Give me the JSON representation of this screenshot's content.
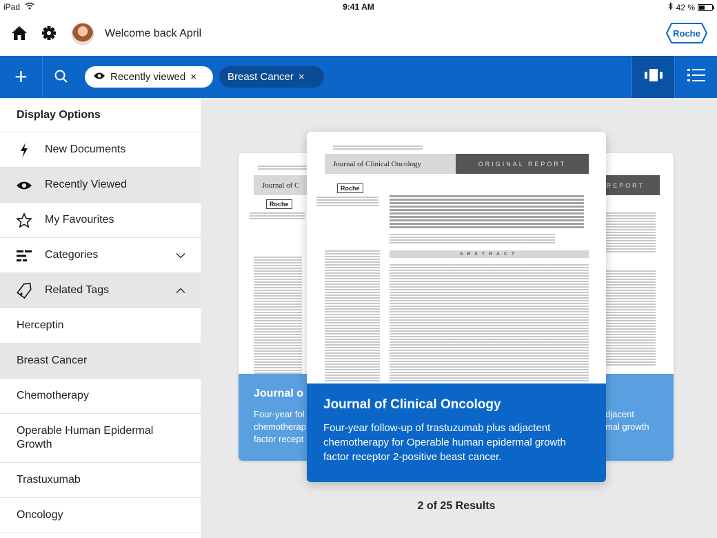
{
  "status_bar": {
    "device": "iPad",
    "time": "9:41 AM",
    "battery": "42 %"
  },
  "header": {
    "welcome": "Welcome back April",
    "logo_text": "Roche"
  },
  "toolbar": {
    "add_label": "+",
    "filters": [
      {
        "label": "Recently viewed",
        "close": "×"
      },
      {
        "label": "Breast Cancer",
        "close": "×"
      }
    ]
  },
  "sidebar": {
    "title": "Display Options",
    "items": [
      {
        "label": "New Documents",
        "icon": "bolt-icon"
      },
      {
        "label": "Recently Viewed",
        "icon": "eye-icon",
        "selected": true
      },
      {
        "label": "My Favourites",
        "icon": "star-icon"
      },
      {
        "label": "Categories",
        "icon": "categories-icon",
        "chevron": "down"
      },
      {
        "label": "Related Tags",
        "icon": "tag-icon",
        "chevron": "up"
      }
    ],
    "tags": [
      {
        "label": "Herceptin"
      },
      {
        "label": "Breast Cancer",
        "selected": true
      },
      {
        "label": "Chemotherapy"
      },
      {
        "label": "Operable Human Epidermal Growth"
      },
      {
        "label": "Trastuxumab"
      },
      {
        "label": "Oncology"
      }
    ]
  },
  "cards": {
    "front": {
      "journal_header": "Journal of Clinical Oncology",
      "report_label": "ORIGINAL REPORT",
      "abstract_label": "ABSTRACT",
      "logo": "Roche",
      "title": "Journal of Clinical Oncology",
      "description": "Four-year follow-up of trastuzumab plus adjactent chemotherapy for Operable human epidermal growth factor receptor 2-positive beast cancer."
    },
    "left": {
      "journal_header": "Journal of C",
      "logo": "Roche",
      "title": "Journal o",
      "desc_line1": "Four-year fol",
      "desc_line2": "chemotherap",
      "desc_line3": "factor recept"
    },
    "right": {
      "report_label": "REPORT",
      "desc_line1": "djacent",
      "desc_line2": "mal growth"
    }
  },
  "results": "2 of 25 Results",
  "colors": {
    "primary": "#0b66c8",
    "dark_chip": "#0a4c96",
    "back_card_footer": "#5aa0e0"
  }
}
